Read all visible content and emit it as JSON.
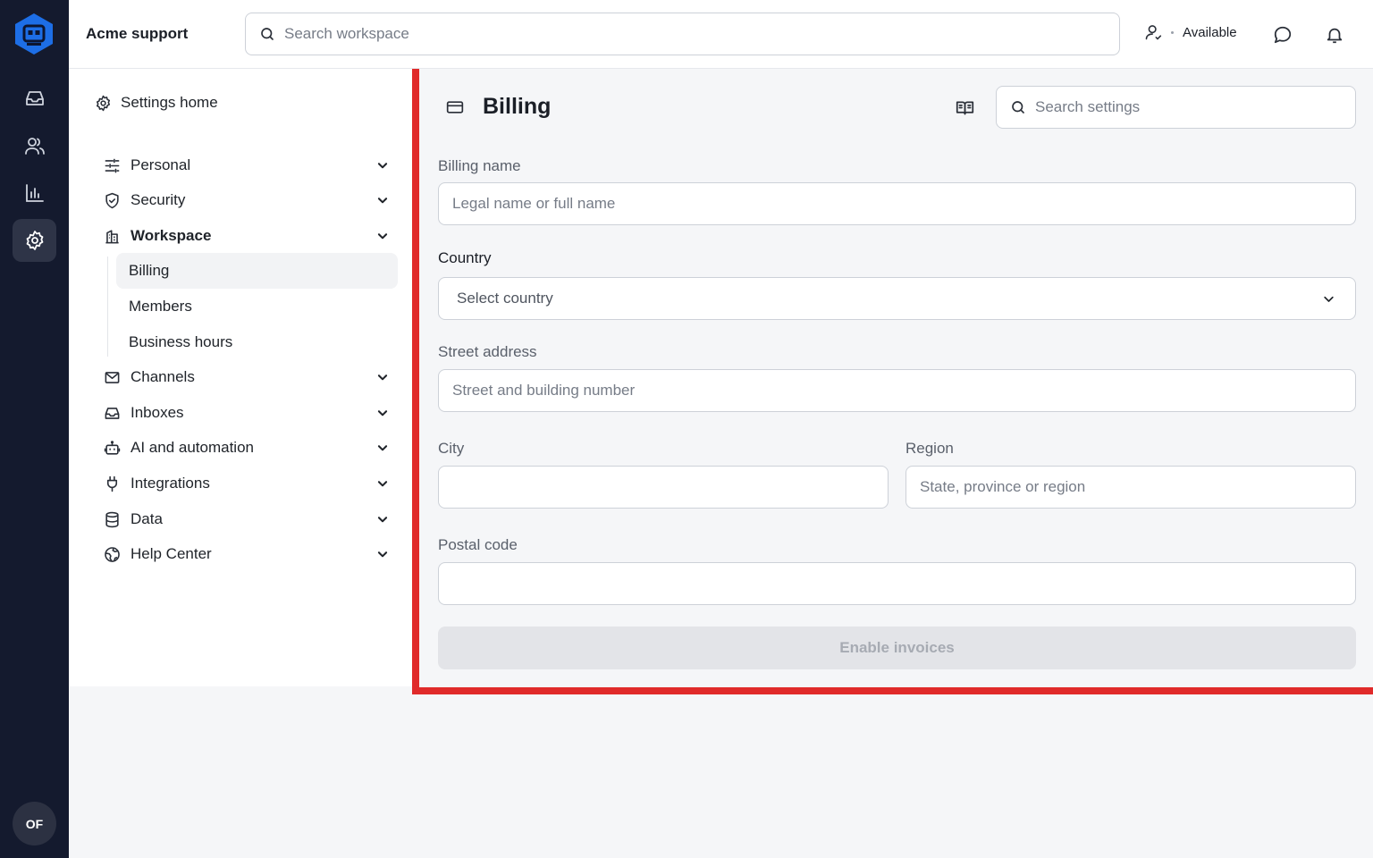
{
  "rail": {
    "items": [
      {
        "name": "inbox",
        "icon": "inbox-icon"
      },
      {
        "name": "contacts",
        "icon": "users-icon"
      },
      {
        "name": "reports",
        "icon": "chart-icon"
      },
      {
        "name": "settings",
        "icon": "gear-icon",
        "active": true
      }
    ],
    "avatar_initials": "OF",
    "brand_color": "#1d6ee6"
  },
  "header": {
    "app_title": "Acme support",
    "search_placeholder": "Search workspace",
    "status_label": "Available"
  },
  "sidebar": {
    "settings_home": "Settings home",
    "items": [
      {
        "label": "Personal",
        "icon": "sliders-icon"
      },
      {
        "label": "Security",
        "icon": "shield-icon"
      },
      {
        "label": "Workspace",
        "icon": "building-icon",
        "expanded": true
      },
      {
        "label": "Channels",
        "icon": "mail-icon"
      },
      {
        "label": "Inboxes",
        "icon": "inbox-icon"
      },
      {
        "label": "AI and automation",
        "icon": "robot-icon"
      },
      {
        "label": "Integrations",
        "icon": "plug-icon"
      },
      {
        "label": "Data",
        "icon": "database-icon"
      },
      {
        "label": "Help Center",
        "icon": "globe-icon"
      }
    ],
    "workspace_children": [
      {
        "label": "Billing",
        "active": true
      },
      {
        "label": "Members"
      },
      {
        "label": "Business hours"
      }
    ]
  },
  "page": {
    "title": "Billing",
    "settings_search_placeholder": "Search settings",
    "form": {
      "billing_name_label": "Billing name",
      "billing_name_placeholder": "Legal name or full name",
      "country_label": "Country",
      "country_value": "Select country",
      "street_label": "Street address",
      "street_placeholder": "Street and building number",
      "city_label": "City",
      "city_value": "",
      "region_label": "Region",
      "region_placeholder": "State, province or region",
      "postal_label": "Postal code",
      "postal_value": "",
      "submit_label": "Enable invoices"
    },
    "highlight_color": "#e02a2a"
  }
}
